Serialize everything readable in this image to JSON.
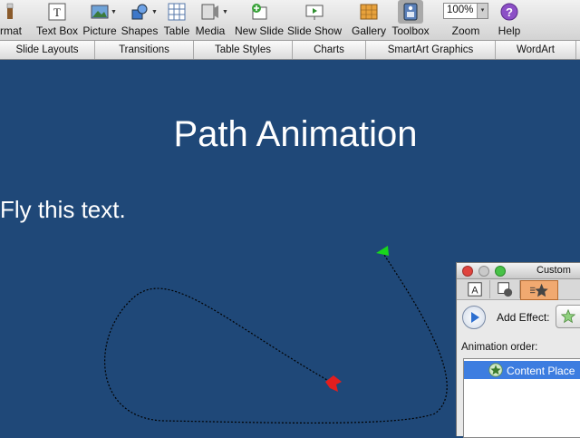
{
  "toolbar": {
    "items": [
      {
        "label": "rmat",
        "icon": "format-brush-icon"
      },
      {
        "label": "Text Box",
        "icon": "text-box-icon"
      },
      {
        "label": "Picture",
        "icon": "picture-icon"
      },
      {
        "label": "Shapes",
        "icon": "shapes-icon"
      },
      {
        "label": "Table",
        "icon": "table-icon"
      },
      {
        "label": "Media",
        "icon": "media-icon"
      },
      {
        "label": "New Slide",
        "icon": "new-slide-icon"
      },
      {
        "label": "Slide Show",
        "icon": "slide-show-icon"
      },
      {
        "label": "Gallery",
        "icon": "gallery-icon"
      },
      {
        "label": "Toolbox",
        "icon": "toolbox-icon"
      },
      {
        "label": "Zoom",
        "value": "100%"
      },
      {
        "label": "Help",
        "icon": "help-icon"
      }
    ]
  },
  "ribbon": {
    "tabs": [
      "Slide Layouts",
      "Transitions",
      "Table Styles",
      "Charts",
      "SmartArt Graphics",
      "WordArt"
    ]
  },
  "slide": {
    "title": "Path Animation",
    "body": "Fly this text.",
    "background_color": "#1f4878",
    "path": {
      "start_marker_color": "#19d61c",
      "end_marker_color": "#e21e1e"
    }
  },
  "palette": {
    "title": "Custom",
    "add_effect_label": "Add Effect:",
    "order_label": "Animation order:",
    "order_items": [
      "Content Place"
    ]
  }
}
